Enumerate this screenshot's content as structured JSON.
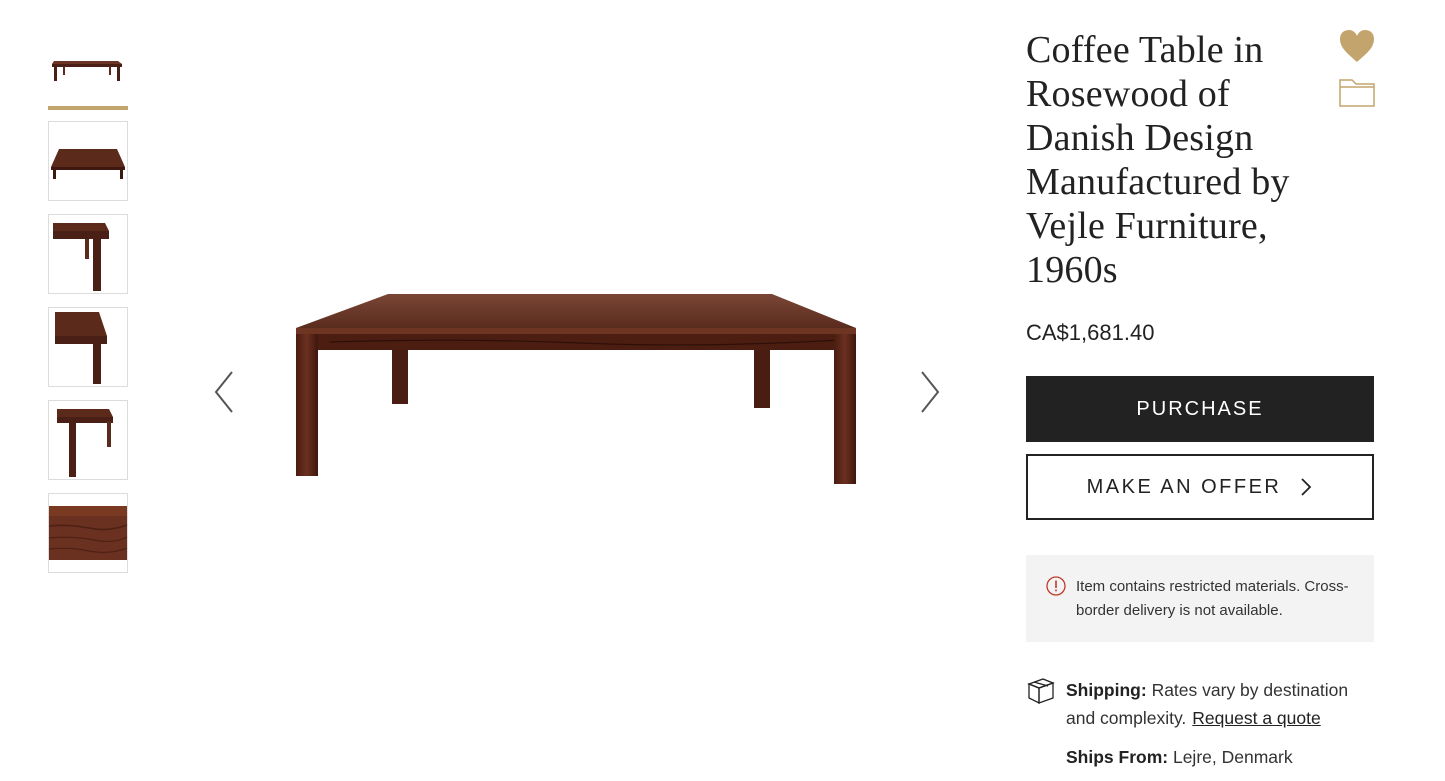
{
  "gallery": {
    "thumbnails": [
      {
        "view": "front-angle"
      },
      {
        "view": "top-angle"
      },
      {
        "view": "corner-detail"
      },
      {
        "view": "corner-close"
      },
      {
        "view": "corner-side"
      },
      {
        "view": "wood-edge"
      }
    ],
    "active_index": 0
  },
  "product": {
    "title": "Coffee Table in Rosewood of Danish Design Manufactured by Vejle Furniture, 1960s",
    "price": "CA$1,681.40"
  },
  "actions": {
    "purchase_label": "PURCHASE",
    "offer_label": "MAKE AN OFFER"
  },
  "notice": {
    "text": "Item contains restricted materials. Cross-border delivery is not available."
  },
  "shipping": {
    "label": "Shipping:",
    "text": "Rates vary by destination and complexity.",
    "link": "Request a quote",
    "ships_from_label": "Ships From:",
    "ships_from_value": "Lejre, Denmark"
  },
  "colors": {
    "accent_gold": "#c3a46d",
    "button_dark": "#222222",
    "wood": "#5a2a1c",
    "notice_bg": "#f3f3f3",
    "alert_red": "#c0392b"
  },
  "icons": [
    "heart-icon",
    "folder-icon",
    "chevron-left-icon",
    "chevron-right-icon",
    "alert-icon",
    "package-icon"
  ]
}
